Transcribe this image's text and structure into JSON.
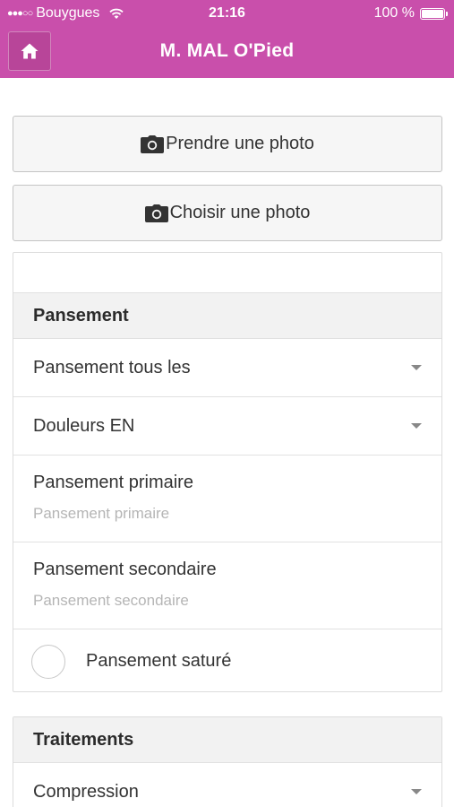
{
  "status_bar": {
    "carrier": "Bouygues",
    "time": "21:16",
    "battery": "100 %"
  },
  "header": {
    "title": "M. MAL O'Pied",
    "home_icon": "home-icon"
  },
  "photo_buttons": {
    "take_photo": "Prendre une photo",
    "choose_photo": "Choisir une photo",
    "icon": "camera-icon"
  },
  "pansement": {
    "header": "Pansement",
    "frequency_select": "Pansement tous les",
    "pain_select": "Douleurs EN",
    "primary": {
      "label": "Pansement primaire",
      "placeholder": "Pansement primaire"
    },
    "secondary": {
      "label": "Pansement secondaire",
      "placeholder": "Pansement secondaire"
    },
    "saturated_label": "Pansement saturé"
  },
  "traitements": {
    "header": "Traitements",
    "compression_select": "Compression"
  },
  "colors": {
    "header_bg": "#c94fab",
    "panel_header_bg": "#f2f2f2"
  }
}
